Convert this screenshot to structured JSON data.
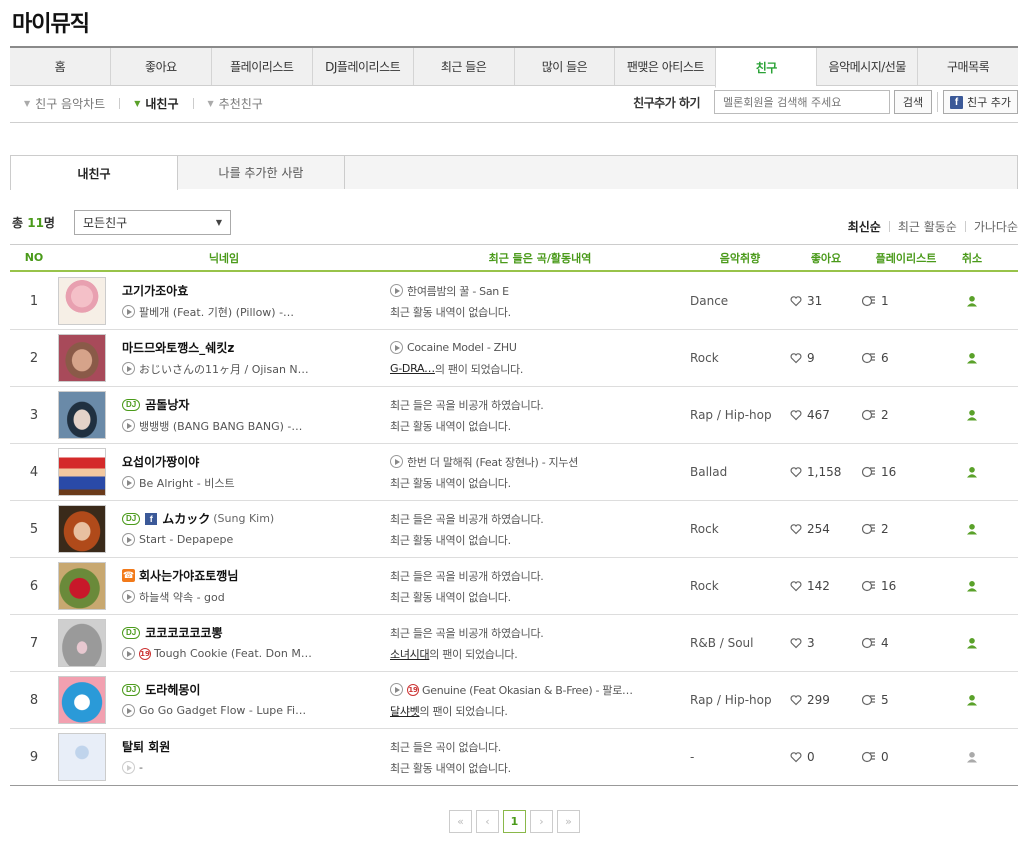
{
  "page": {
    "title": "마이뮤직"
  },
  "main_tabs": [
    {
      "label": "홈"
    },
    {
      "label": "좋아요"
    },
    {
      "label": "플레이리스트"
    },
    {
      "label": "DJ플레이리스트"
    },
    {
      "label": "최근 들은"
    },
    {
      "label": "많이 들은"
    },
    {
      "label": "팬맺은 아티스트"
    },
    {
      "label": "친구"
    },
    {
      "label": "음악메시지/선물"
    },
    {
      "label": "구매목록"
    }
  ],
  "subnav": [
    {
      "label": "친구 음악차트"
    },
    {
      "label": "내친구"
    },
    {
      "label": "추천친구"
    }
  ],
  "friend_add": {
    "label": "친구추가 하기",
    "search_placeholder": "멜론회원을 검색해 주세요",
    "search_button": "검색",
    "fb_button": "친구 추가"
  },
  "sub_tabs": [
    {
      "label": "내친구"
    },
    {
      "label": "나를 추가한 사람"
    }
  ],
  "summary": {
    "prefix": "총 ",
    "count": "11",
    "suffix": "명"
  },
  "filter": {
    "selected": "모든친구"
  },
  "sort": [
    {
      "label": "최신순"
    },
    {
      "label": "최근 활동순"
    },
    {
      "label": "가나다순"
    }
  ],
  "table_headers": {
    "no": "NO",
    "nick": "닉네임",
    "activity": "최근 들은 곡/활동내역",
    "genre": "음악취향",
    "likes": "좋아요",
    "playlists": "플레이리스트",
    "cancel": "취소"
  },
  "rows": [
    {
      "no": "1",
      "nick": "고기가조아효",
      "nick_sub": "",
      "song": "팔베개 (Feat. 기현) (Pillow) -…",
      "act1": "한여름밤의 꿀 - San E",
      "act1_play": true,
      "act2_link": "",
      "act2": "최근 활동 내역이 없습니다.",
      "genre": "Dance",
      "likes": "31",
      "playlists": "1"
    },
    {
      "no": "2",
      "nick": "마드므와토깽스_쉐킷z",
      "nick_sub": "",
      "song": "おじいさんの11ヶ月 / Ojisan N…",
      "act1": "Cocaine Model - ZHU",
      "act1_play": true,
      "act2_link": "G-DRA…",
      "act2": " 의 팬이 되었습니다.",
      "genre": "Rock",
      "likes": "9",
      "playlists": "6"
    },
    {
      "no": "3",
      "nick": "곰돌낭자",
      "nick_sub": "",
      "song": "뱅뱅뱅 (BANG BANG BANG) -…",
      "act1": "최근 들은 곡을 비공개 하였습니다.",
      "act1_play": false,
      "act2_link": "",
      "act2": "최근 활동 내역이 없습니다.",
      "genre": "Rap / Hip-hop",
      "likes": "467",
      "playlists": "2"
    },
    {
      "no": "4",
      "nick": "요섭이가짱이야",
      "nick_sub": "",
      "song": "Be Alright - 비스트",
      "act1": "한번 더 말해줘 (Feat 장현나) - 지누션",
      "act1_play": true,
      "act2_link": "",
      "act2": "최근 활동 내역이 없습니다.",
      "genre": "Ballad",
      "likes": "1,158",
      "playlists": "16"
    },
    {
      "no": "5",
      "nick": "ムカック",
      "nick_sub": "(Sung Kim)",
      "song": "Start - Depapepe",
      "act1": "최근 들은 곡을 비공개 하였습니다.",
      "act1_play": false,
      "act2_link": "",
      "act2": "최근 활동 내역이 없습니다.",
      "genre": "Rock",
      "likes": "254",
      "playlists": "2"
    },
    {
      "no": "6",
      "nick": "회사는가야죠토깽님",
      "nick_sub": "",
      "song": "하늘색 약속 - god",
      "act1": "최근 들은 곡을 비공개 하였습니다.",
      "act1_play": false,
      "act2_link": "",
      "act2": "최근 활동 내역이 없습니다.",
      "genre": "Rock",
      "likes": "142",
      "playlists": "16"
    },
    {
      "no": "7",
      "nick": "코코코코코코뽕",
      "nick_sub": "",
      "song": "Tough Cookie (Feat. Don M…",
      "act1": "최근 들은 곡을 비공개 하였습니다.",
      "act1_play": false,
      "act2_link": "소녀시대",
      "act2": "의 팬이 되었습니다.",
      "genre": "R&B / Soul",
      "likes": "3",
      "playlists": "4"
    },
    {
      "no": "8",
      "nick": "도라헤몽이",
      "nick_sub": "",
      "song": "Go Go Gadget Flow - Lupe Fi…",
      "act1": "Genuine (Feat Okasian & B-Free) - 팔로…",
      "act1_play": true,
      "act2_link": "달샤벳",
      "act2": "의 팬이 되었습니다.",
      "genre": "Rap / Hip-hop",
      "likes": "299",
      "playlists": "5"
    },
    {
      "no": "9",
      "nick": "탈퇴 회원",
      "nick_sub": "",
      "song": "-",
      "act1": "최근 들은 곡이 없습니다.",
      "act1_play": false,
      "act2_link": "",
      "act2": "최근 활동 내역이 없습니다.",
      "genre": "-",
      "likes": "0",
      "playlists": "0"
    }
  ],
  "badges": {
    "dj": "DJ",
    "fb": "f",
    "phone": "☎",
    "age": "19"
  },
  "pagination": {
    "current": "1",
    "first": "«",
    "prev": "‹",
    "next": "›",
    "last": "»"
  },
  "colors": {
    "accent": "#4a9a1a",
    "tab_active": "#2aa236",
    "header_line": "#98c34a",
    "facebook": "#3b5998"
  }
}
